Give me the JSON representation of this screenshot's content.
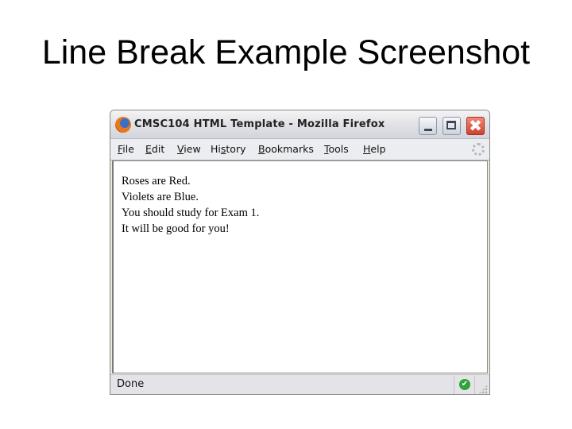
{
  "slide": {
    "title": "Line Break Example Screenshot"
  },
  "window": {
    "title": "CMSC104 HTML Template - Mozilla Firefox",
    "icon": "firefox-icon",
    "controls": {
      "minimize": "minimize-icon",
      "maximize": "maximize-icon",
      "close": "✖"
    }
  },
  "menu": {
    "items": [
      {
        "accel": "F",
        "rest": "ile"
      },
      {
        "accel": "E",
        "rest": "dit"
      },
      {
        "accel": "V",
        "rest": "iew"
      },
      {
        "pre": "Hi",
        "accel": "s",
        "rest": "tory"
      },
      {
        "accel": "B",
        "rest": "ookmarks"
      },
      {
        "accel": "T",
        "rest": "ools"
      },
      {
        "accel": "H",
        "rest": "elp"
      }
    ],
    "throbber": "activity-throbber-icon"
  },
  "content": {
    "lines": [
      "Roses are Red.",
      "Violets are Blue.",
      "You should study for Exam 1.",
      "It will be good for you!"
    ]
  },
  "status": {
    "text": "Done",
    "ok_icon": "✔"
  }
}
